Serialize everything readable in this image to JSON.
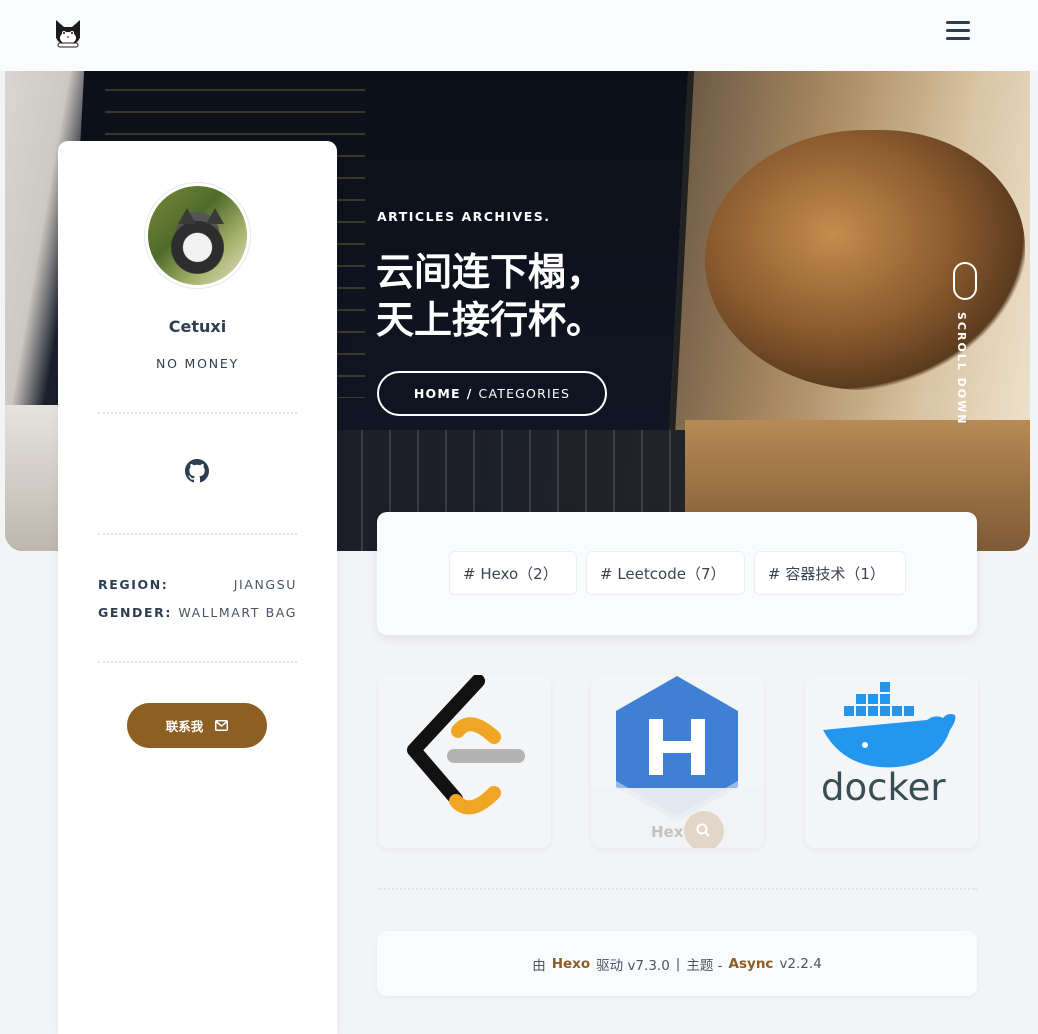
{
  "header": {
    "logo_icon": "cat-face-icon",
    "menu_icon": "hamburger-menu-icon"
  },
  "hero": {
    "kicker": "ARTICLES ARCHIVES.",
    "title_line1": "云间连下榻，",
    "title_line2": "天上接行杯。",
    "breadcrumb": {
      "home": "HOME",
      "separator": "/",
      "current": "CATEGORIES"
    },
    "scroll_label": "SCROLL DOWN"
  },
  "profile": {
    "avatar_icon": "cat-avatar",
    "name": "Cetuxi",
    "tagline": "NO MONEY",
    "social_icon": "github-icon",
    "info": [
      {
        "key": "REGION:",
        "value": "JIANGSU"
      },
      {
        "key": "GENDER:",
        "value": "WALLMART BAG"
      }
    ],
    "contact_label": "联系我",
    "contact_icon": "mail-icon",
    "accent_color": "#8d5f23"
  },
  "categories": [
    {
      "label": "# Hexo（2）"
    },
    {
      "label": "# Leetcode（7）"
    },
    {
      "label": "# 容器技术（1）"
    }
  ],
  "thumbnails": [
    {
      "name": "leetcode-logo"
    },
    {
      "name": "hexo-logo",
      "caption": "Hexo"
    },
    {
      "name": "docker-logo",
      "caption": "docker"
    }
  ],
  "footer": {
    "prefix": "由",
    "engine": "Hexo",
    "engine_suffix": "驱动 v7.3.0",
    "sep": "|",
    "theme_prefix": "主题 -",
    "theme": "Async",
    "theme_version": "v2.2.4"
  }
}
